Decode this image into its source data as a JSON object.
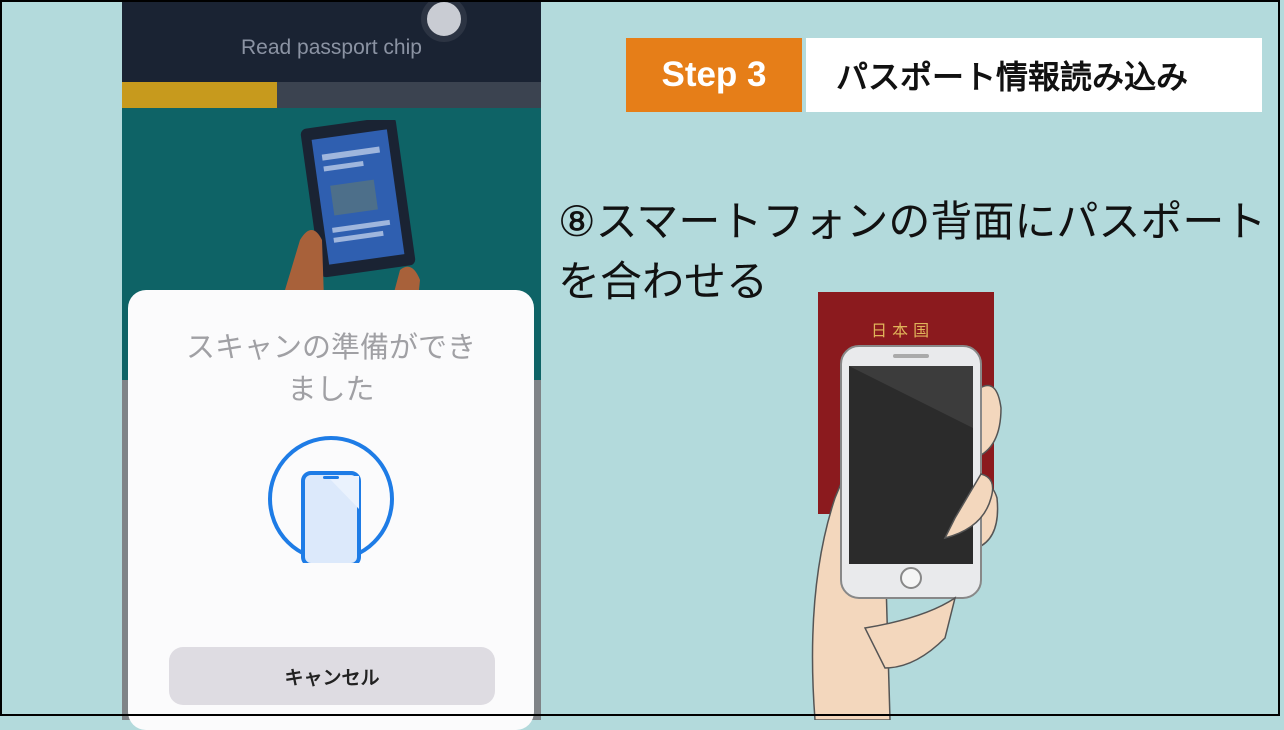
{
  "phone_screen": {
    "header_title": "Read passport chip",
    "progress_fraction": 0.37,
    "scan_sheet": {
      "title": "スキャンの準備ができました",
      "cancel_label": "キャンセル"
    }
  },
  "step_banner": {
    "badge_text": "Step 3",
    "title": "パスポート情報読み込み"
  },
  "instruction": "⑧スマートフォンの背面にパスポートを合わせる",
  "passport_cover_text": "日 本 国",
  "colors": {
    "background": "#b3dadc",
    "step_orange": "#e67e18",
    "passport_red": "#8b1a1e",
    "scan_blue": "#1e7ce6"
  },
  "icons": [
    "scan-phone-icon",
    "camera-lens-icon",
    "passport-phone-illustration",
    "hand-phone-passport-photo"
  ]
}
